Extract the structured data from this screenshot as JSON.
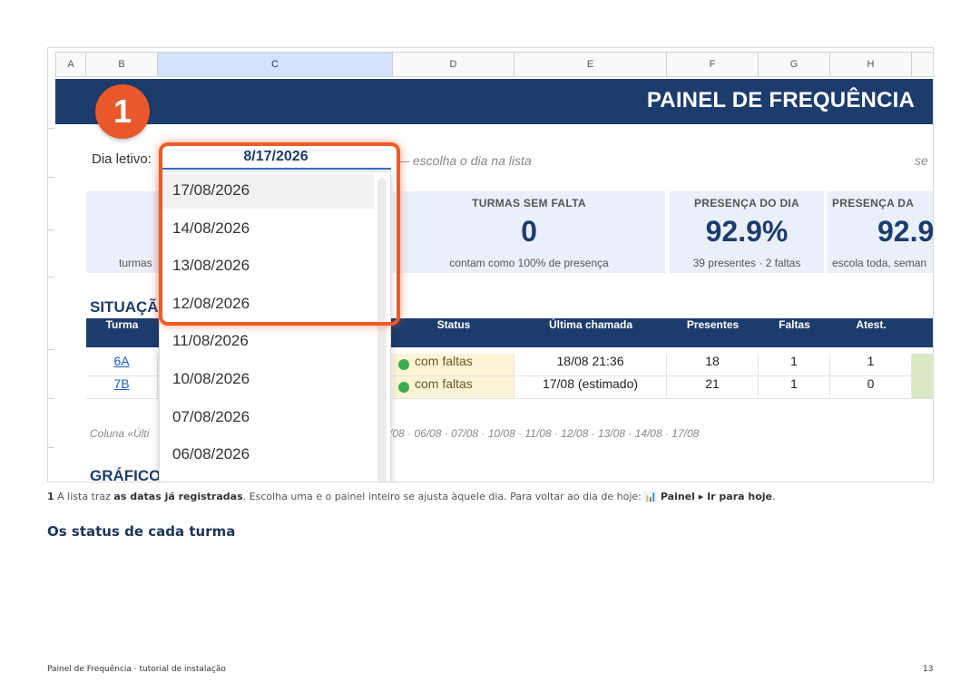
{
  "sheet": {
    "columns": [
      "A",
      "B",
      "C",
      "D",
      "E",
      "F",
      "G",
      "H"
    ],
    "selected_column": "C",
    "banner_title": "PAINEL DE FREQUÊNCIA",
    "callout_number": "1",
    "dia_label": "Dia letivo:",
    "selected_date": "8/17/2026",
    "hint": "— escolha o dia na lista",
    "right_cut_text": "se",
    "kpis": [
      {
        "title": "",
        "value": "",
        "sub": "turmas"
      },
      {
        "title": "TURMAS SEM FALTA",
        "value": "0",
        "sub": "contam como 100% de presença"
      },
      {
        "title": "PRESENÇA DO DIA",
        "value": "92.9%",
        "sub": "39 presentes · 2 faltas"
      },
      {
        "title": "PRESENÇA DA",
        "value": "92.9",
        "sub": "escola toda, seman"
      }
    ],
    "section_situacao": "SITUAÇÃ",
    "table_headers": [
      "Turma",
      "Status",
      "Última chamada",
      "Presentes",
      "Faltas",
      "Atest."
    ],
    "rows": [
      {
        "turma": "6A",
        "status": "com faltas",
        "ultima": "18/08 21:36",
        "presentes": "18",
        "faltas": "1",
        "atest": "1"
      },
      {
        "turma": "7B",
        "status": "com faltas",
        "ultima": "17/08 (estimado)",
        "presentes": "21",
        "faltas": "1",
        "atest": "0"
      }
    ],
    "note_left": "Coluna «Últi",
    "note_right": "/08 · 06/08 · 07/08 · 10/08 · 11/08 · 12/08 · 13/08 · 14/08 · 17/08",
    "section_graficos": "GRÁFICO",
    "dropdown_options": [
      "17/08/2026",
      "14/08/2026",
      "13/08/2026",
      "12/08/2026",
      "11/08/2026",
      "10/08/2026",
      "07/08/2026",
      "06/08/2026"
    ]
  },
  "caption": {
    "number": "1",
    "t1": " A lista traz ",
    "b1": "as datas já registradas",
    "t2": ". Escolha uma e o painel inteiro se ajusta àquele dia. Para voltar ao dia de hoje: ",
    "icon": "📊",
    "b2": " Painel ▸ Ir para hoje",
    "t3": "."
  },
  "heading": "Os status de cada turma",
  "footer": {
    "left": "Painel de Frequência · tutorial de instalação",
    "page": "13"
  },
  "colors": {
    "banner": "#1d3c6e",
    "badge": "#e8582a",
    "highlight_frame": "#ee5a24",
    "status_dot": "#3cad4f"
  }
}
